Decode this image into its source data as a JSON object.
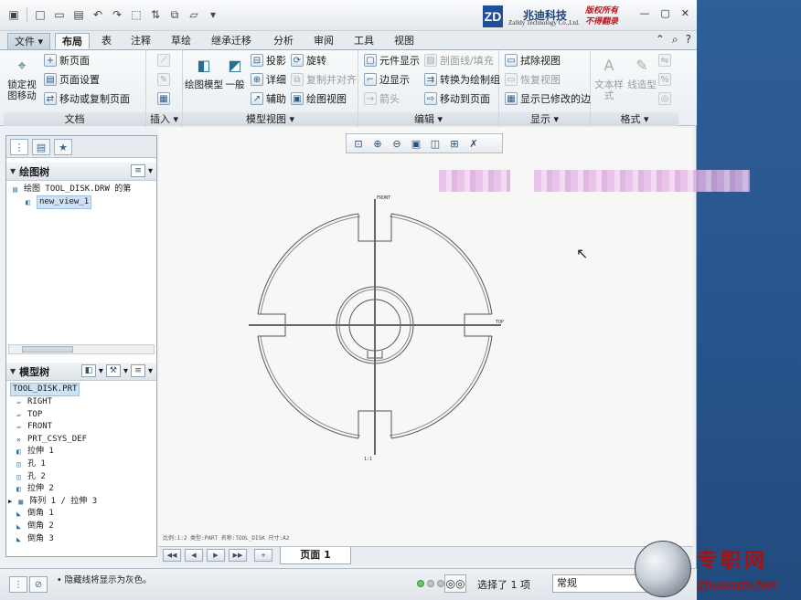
{
  "quick_access": {
    "icons": [
      "new-icon",
      "open-icon",
      "save-icon",
      "undo-icon",
      "redo-icon",
      "select-box-icon",
      "regenerate-icon",
      "windows-icon",
      "close-window-icon",
      "more-icon"
    ]
  },
  "brand": {
    "logo_letters": "ZD",
    "name_cn": "兆迪科技",
    "name_en": "Zalldy Technology Co.,Ltd.",
    "rights_1": "版权所有",
    "rights_2": "不得翻录"
  },
  "window_controls": {
    "minimize": "—",
    "maximize": "▢",
    "close": "✕"
  },
  "tabs": [
    "文件",
    "布局",
    "表",
    "注释",
    "草绘",
    "继承迁移",
    "分析",
    "审阅",
    "工具",
    "视图"
  ],
  "active_tab": "布局",
  "ribbon": {
    "doc": {
      "label": "文档",
      "lock_view": "锁定视图移动",
      "new_page": "新页面",
      "page_setup": "页面设置",
      "move_copy_page": "移动或复制页面"
    },
    "insert": {
      "label": "插入"
    },
    "model_views": {
      "label": "模型视图",
      "drawing_model": "绘图模型",
      "general": "一般",
      "projection": "投影",
      "detailed": "详细",
      "auxiliary": "辅助",
      "revolve": "旋转",
      "copy_align": "复制并对齐",
      "drawing_view": "绘图视图"
    },
    "edit": {
      "label": "编辑",
      "element_display": "元件显示",
      "edge_display": "边显示",
      "arrow": "箭头",
      "xhatch": "剖面线/填充",
      "convert_draft": "转换为绘制组",
      "move_to_page": "移动到页面"
    },
    "display": {
      "label": "显示",
      "erase_view": "拭除视图",
      "resume_view": "恢复视图",
      "show_modified_edges": "显示已修改的边"
    },
    "format": {
      "label": "格式",
      "text_style": "文本样式",
      "line_style": "线造型"
    }
  },
  "left_panel": {
    "drawing_tree": {
      "title": "绘图树",
      "items": [
        "绘图 TOOL_DISK.DRW 的第",
        "new_view_1"
      ]
    },
    "model_tree": {
      "title": "模型树",
      "root": "TOOL_DISK.PRT",
      "items": [
        {
          "label": "RIGHT",
          "icon": "datum-plane-icon"
        },
        {
          "label": "TOP",
          "icon": "datum-plane-icon"
        },
        {
          "label": "FRONT",
          "icon": "datum-plane-icon"
        },
        {
          "label": "PRT_CSYS_DEF",
          "icon": "csys-icon"
        },
        {
          "label": "拉伸 1",
          "icon": "extrude-icon"
        },
        {
          "label": "孔 1",
          "icon": "hole-icon"
        },
        {
          "label": "孔 2",
          "icon": "hole-icon"
        },
        {
          "label": "拉伸 2",
          "icon": "extrude-icon"
        },
        {
          "label": "阵列 1 / 拉伸 3",
          "icon": "pattern-icon"
        },
        {
          "label": "倒角 1",
          "icon": "chamfer-icon"
        },
        {
          "label": "倒角 2",
          "icon": "chamfer-icon"
        },
        {
          "label": "倒角 3",
          "icon": "chamfer-icon"
        }
      ]
    }
  },
  "drawing": {
    "label_front": "FRONT",
    "label_top": "TOP",
    "label_scale": "1:1"
  },
  "canvas_info": "比例:1:2   类型:PART  名称:TOOL_DISK  尺寸:A2",
  "page_tab": "页面 1",
  "status": {
    "message": "隐藏线将显示为灰色。",
    "selected": "选择了 1 项",
    "filter": "常规"
  },
  "watermark": {
    "cn": "专职网",
    "en": "Zhuanzhi.Net"
  },
  "colors": {
    "accent": "#2c5a86",
    "desktop": "#2d5a8e",
    "watermark": "#a51212"
  }
}
